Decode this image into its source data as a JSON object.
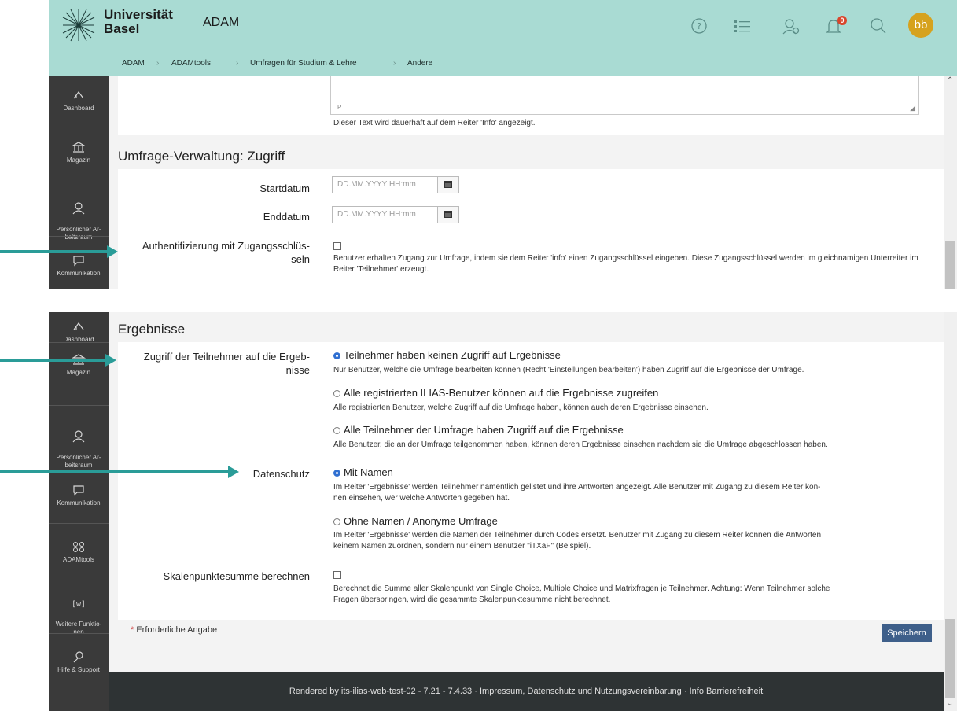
{
  "header": {
    "brand_line1": "Universität",
    "brand_line2": "Basel",
    "app_name": "ADAM",
    "notification_count": "0",
    "avatar_initials": "bb",
    "breadcrumb": [
      "ADAM",
      "ADAMtools",
      "Umfragen für Studium & Lehre",
      "Andere"
    ],
    "icons": [
      "help-icon",
      "list-icon",
      "contacts-icon",
      "bell-icon",
      "search-icon"
    ]
  },
  "sidebar_top": [
    {
      "label": "Dashboard",
      "icon": "dashboard-icon"
    },
    {
      "label": "Magazin",
      "icon": "magazin-icon"
    },
    {
      "label": "Persönlicher Ar-\nbeitsraum",
      "icon": "workspace-icon"
    },
    {
      "label": "Kommunikation",
      "icon": "communication-icon"
    }
  ],
  "sidebar_bottom": [
    {
      "label": "Dashboard",
      "icon": "dashboard-icon"
    },
    {
      "label": "Magazin",
      "icon": "magazin-icon"
    },
    {
      "label": "Persönlicher Ar-\nbeitsraum",
      "icon": "workspace-icon"
    },
    {
      "label": "Kommunikation",
      "icon": "communication-icon"
    },
    {
      "label": "ADAMtools",
      "icon": "tools-icon"
    },
    {
      "label": "Weitere Funktio-\nnen",
      "icon": "more-icon"
    },
    {
      "label": "Hilfe & Support",
      "icon": "help-support-icon"
    }
  ],
  "top_form": {
    "textarea_tag": "P",
    "textarea_hint": "Dieser Text wird dauerhaft auf dem Reiter 'Info' angezeigt.",
    "section_title": "Umfrage-Verwaltung: Zugriff",
    "start_label": "Startdatum",
    "start_placeholder": "DD.MM.YYYY HH:mm",
    "end_label": "Enddatum",
    "end_placeholder": "DD.MM.YYYY HH:mm",
    "auth_label": "Authentifizierung mit Zugangsschlüs-\nseln",
    "auth_checked": false,
    "auth_desc": "Benutzer erhalten Zugang zur Umfrage, indem sie dem Reiter 'info' einen Zugangsschlüssel eingeben. Diese Zugangsschlüssel werden im gleichnamigen Unterreiter im Reiter 'Teilnehmer' erzeugt."
  },
  "results_form": {
    "section_title": "Ergebnisse",
    "access_label": "Zugriff der Teilnehmer auf die Ergeb-\nnisse",
    "access_options": [
      {
        "label": "Teilnehmer haben keinen Zugriff auf Ergebnisse",
        "desc": "Nur Benutzer, welche die Umfrage bearbeiten können (Recht 'Einstellungen bearbeiten') haben Zugriff auf die Ergebnisse der Umfrage.",
        "selected": true
      },
      {
        "label": "Alle registrierten ILIAS-Benutzer können auf die Ergebnisse zugreifen",
        "desc": "Alle registrierten Benutzer, welche Zugriff auf die Umfrage haben, können auch deren Ergebnisse einsehen.",
        "selected": false
      },
      {
        "label": "Alle Teilnehmer der Umfrage haben Zugriff auf die Ergebnisse",
        "desc": "Alle Benutzer, die an der Umfrage teilgenommen haben, können deren Ergebnisse einsehen nachdem sie die Umfrage abgeschlossen haben.",
        "selected": false
      }
    ],
    "privacy_label": "Datenschutz",
    "privacy_options": [
      {
        "label": "Mit Namen",
        "desc": "Im Reiter 'Ergebnisse' werden Teilnehmer namentlich gelistet und ihre Antworten angezeigt. Alle Benutzer mit Zugang zu diesem Reiter kön-\nnen einsehen, wer welche Antworten gegeben hat.",
        "selected": true
      },
      {
        "label": "Ohne Namen / Anonyme Umfrage",
        "desc": "Im Reiter 'Ergebnisse' werden die Namen der Teilnehmer durch Codes ersetzt. Benutzer mit Zugang zu diesem Reiter können die Antworten\nkeinem Namen zuordnen, sondern nur einem Benutzer \"iTXaF\" (Beispiel).",
        "selected": false
      }
    ],
    "scale_label": "Skalenpunktesumme berechnen",
    "scale_checked": false,
    "scale_desc": "Berechnet die Summe aller Skalenpunkt von Single Choice, Multiple Choice und Matrixfragen je Teilnehmer. Achtung: Wenn Teilnehmer solche\nFragen überspringen, wird die gesammte Skalenpunktesumme nicht berechnet.",
    "required_star": "*",
    "required_note": "Erforderliche Angabe",
    "save_label": "Speichern"
  },
  "footer": {
    "rendered_by": "Rendered by its-ilias-web-test-02 - 7.21 - 7.4.33",
    "sep": "·",
    "imprint": "Impressum, Datenschutz und Nutzungsvereinbarung",
    "accessibility": "Info Barrierefreiheit"
  },
  "colors": {
    "header_bg": "#a9dbd3",
    "sidebar_bg": "#3a3a3a",
    "accent": "#2a9c98",
    "save_bg": "#3e5f8a",
    "avatar": "#d6a21e",
    "badge": "#d9452b"
  }
}
